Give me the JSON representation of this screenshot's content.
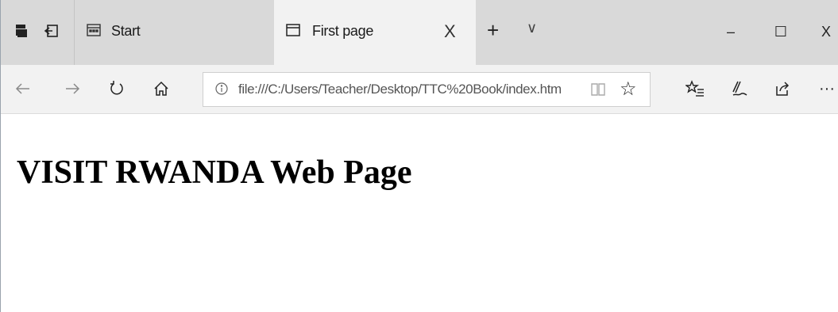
{
  "tabs": [
    {
      "label": "Start",
      "active": false
    },
    {
      "label": "First page",
      "active": true
    }
  ],
  "tab_close_glyph": "X",
  "new_tab_glyph": "+",
  "tab_list_glyph": "∨",
  "window_controls": {
    "minimize": "–",
    "maximize": "☐",
    "close": "X"
  },
  "address_bar": {
    "url": "file:///C:/Users/Teacher/Desktop/TTC%20Book/index.htm"
  },
  "toolbar": {
    "more_glyph": "···"
  },
  "page": {
    "heading": "VISIT RWANDA Web Page"
  },
  "icons": [
    "tab-preview-icon",
    "set-aside-tabs-icon",
    "start-page-icon",
    "page-icon",
    "back-icon",
    "forward-icon",
    "refresh-icon",
    "home-icon",
    "info-icon",
    "reading-view-icon",
    "favorite-star-icon",
    "favorites-hub-icon",
    "pen-icon",
    "share-icon",
    "more-icon"
  ],
  "colors": {
    "tab_strip": "#d9d9d9",
    "active_tab": "#f2f2f2",
    "page_bg": "#ffffff"
  }
}
